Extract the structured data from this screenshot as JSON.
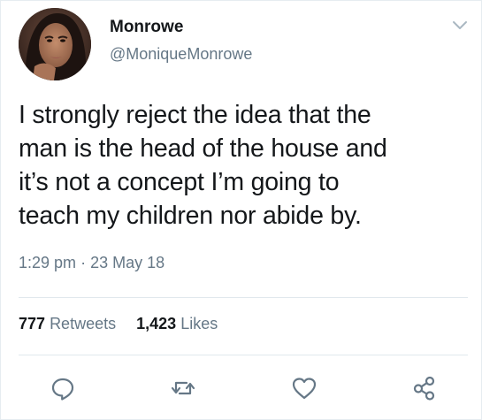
{
  "user": {
    "display_name": "Monrowe",
    "handle": "@MoniqueMonrowe"
  },
  "tweet": {
    "lines": [
      "I strongly reject the idea that the",
      "man is the head of the house and",
      "it’s not a concept I’m going to",
      "teach my children nor abide by."
    ],
    "time": "1:29 pm",
    "separator": "·",
    "date": "23 May 18"
  },
  "stats": {
    "retweets_count": "777",
    "retweets_label": "Retweets",
    "likes_count": "1,423",
    "likes_label": "Likes"
  },
  "icons": {
    "menu": "chevron-down-icon",
    "reply": "reply-icon",
    "retweet": "retweet-icon",
    "like": "heart-icon",
    "share": "share-icon"
  },
  "colors": {
    "text": "#14171a",
    "secondary": "#657786",
    "divider": "#e1e8ed"
  }
}
